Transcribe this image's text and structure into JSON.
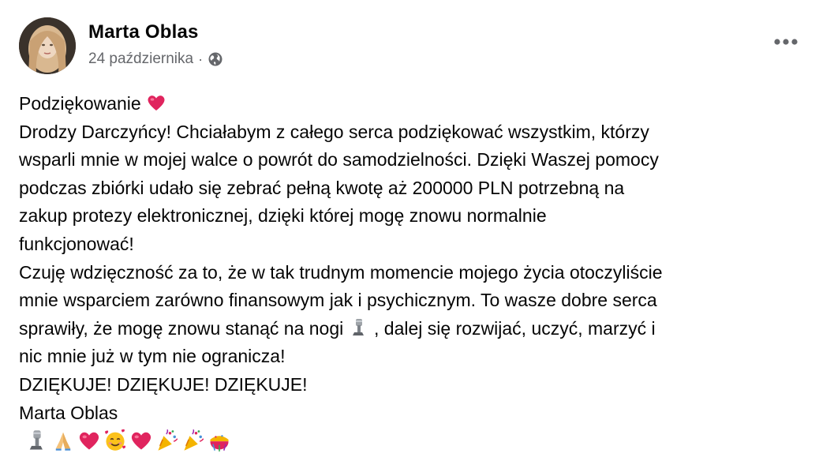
{
  "post": {
    "author": "Marta Oblas",
    "date": "24 października",
    "separator": "·",
    "audience_icon": "globe-icon",
    "more_icon": "more-icon",
    "lines": [
      "Podziękowanie",
      "Drodzy Darczyńcy! Chciałabym z całego serca podziękować wszystkim, którzy",
      "wsparli mnie w mojej walce o powrót do samodzielności.  Dzięki Waszej pomocy",
      "podczas zbiórki udało się zebrać pełną kwotę aż 200000 PLN  potrzebną na",
      "zakup  protezy elektronicznej,  dzięki której mogę znowu normalnie",
      "funkcjonować!",
      "Czuję wdzięczność za to, że w tak trudnym momencie mojego życia otoczyliście",
      "mnie wsparciem zarówno finansowym jak i psychicznym. To wasze dobre serca",
      "sprawiły, że mogę znowu stanąć na nogi",
      ", dalej się rozwijać, uczyć, marzyć i",
      "nic mnie już w tym nie ogranicza!",
      "DZIĘKUJE! DZIĘKUJE! DZIĘKUJE!",
      "Marta Oblas"
    ],
    "inline_emojis": [
      "red-heart-emoji",
      "mechanical-leg-emoji"
    ],
    "trailing_emojis": [
      "mechanical-leg-emoji",
      "folded-hands-emoji",
      "red-heart-emoji",
      "smiling-face-with-hearts-emoji",
      "red-heart-emoji",
      "party-popper-emoji",
      "party-popper-emoji",
      "confetti-ball-emoji"
    ],
    "colors": {
      "text": "#050505",
      "secondary_text": "#65676b",
      "heart": "#e0245e"
    }
  }
}
